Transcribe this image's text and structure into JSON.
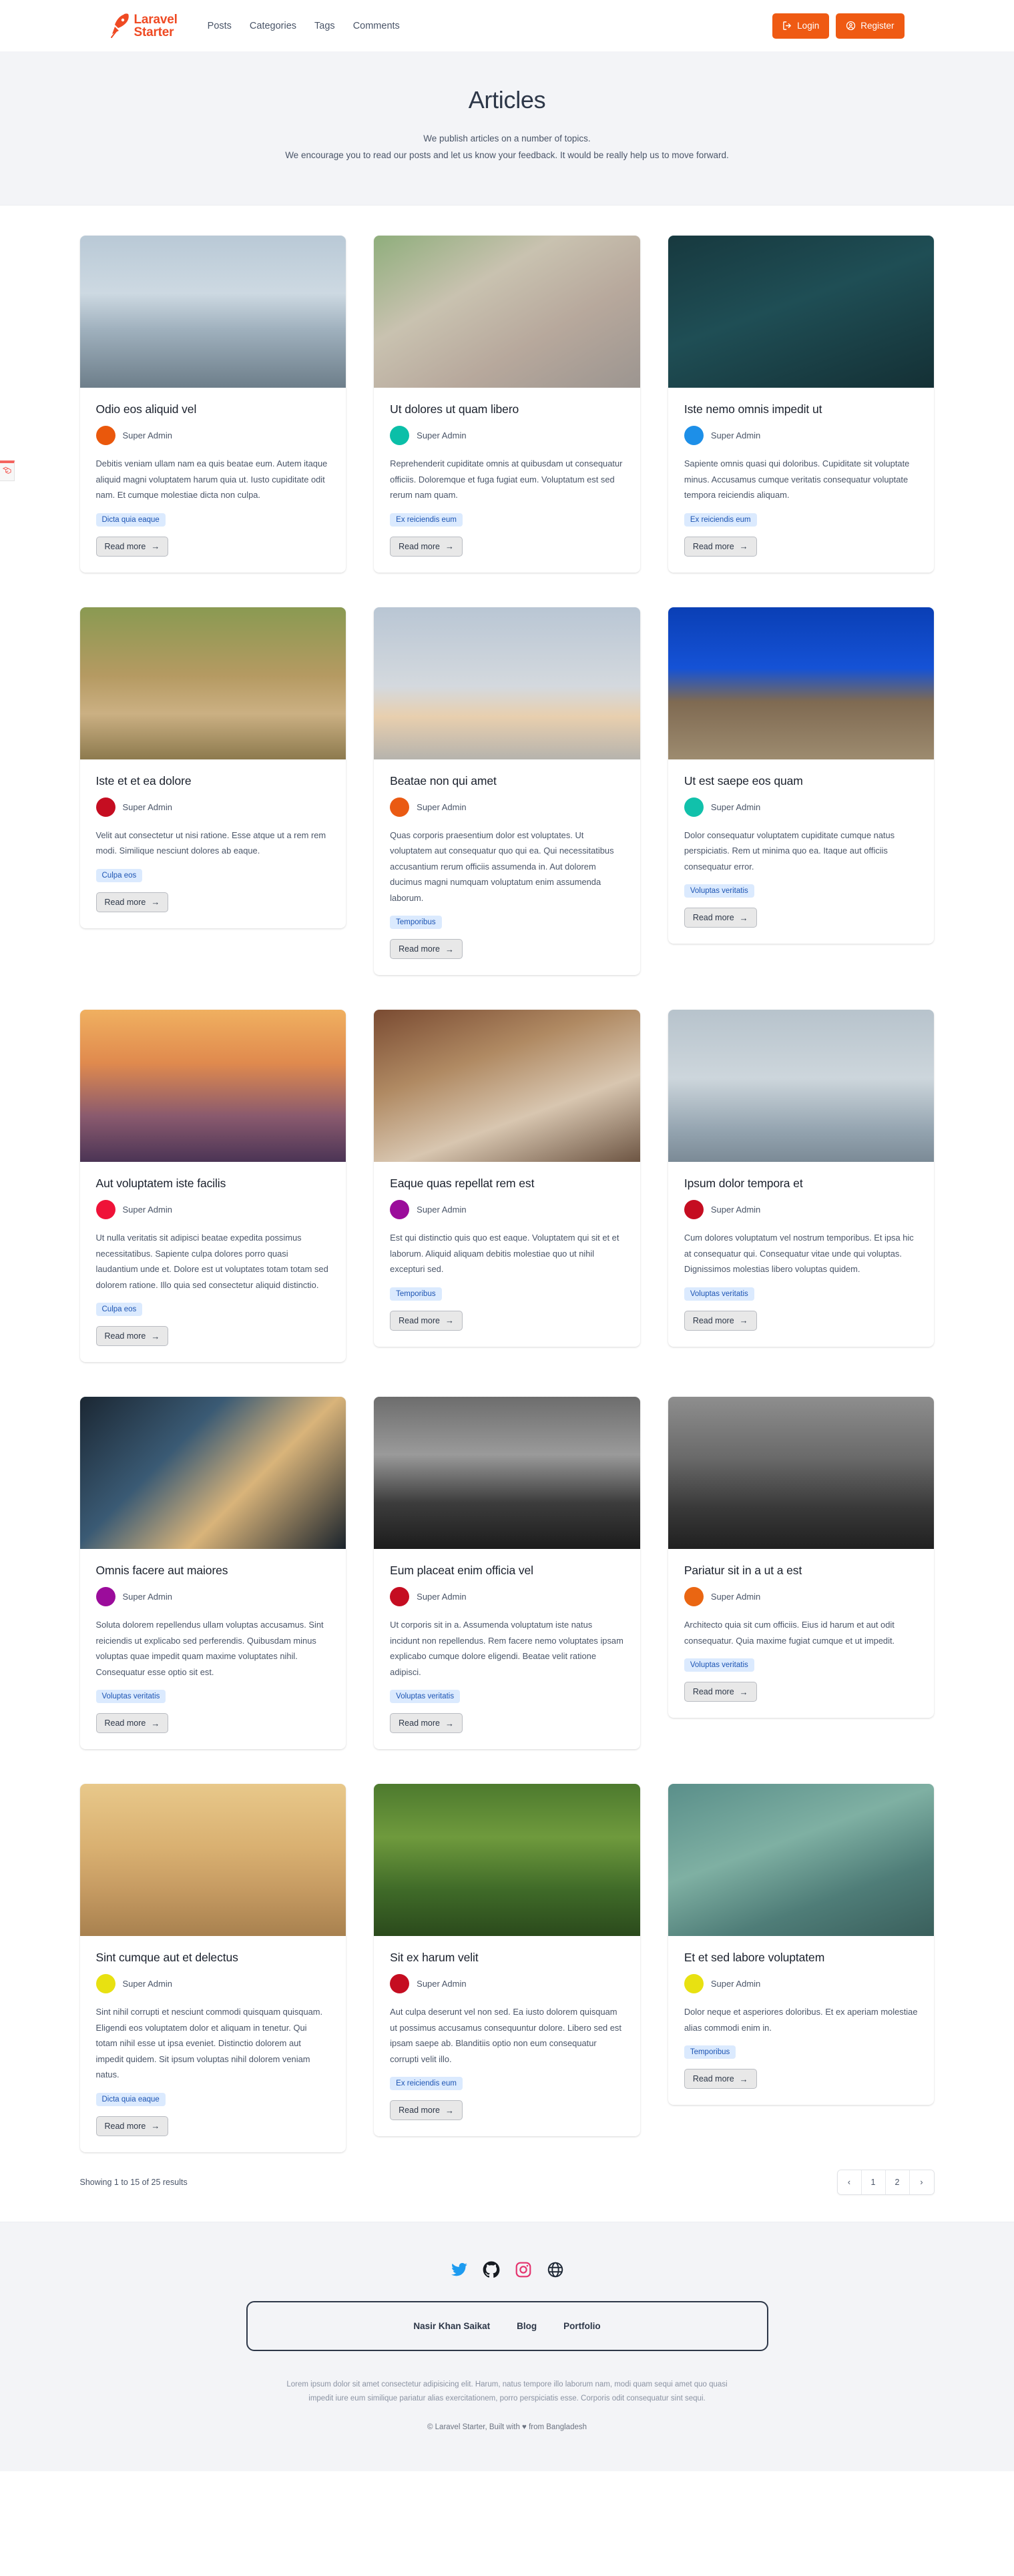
{
  "navbar": {
    "brand_line1": "Laravel",
    "brand_line2": "Starter",
    "brand_icon": "rocket-icon",
    "links": [
      {
        "label": "Posts"
      },
      {
        "label": "Categories"
      },
      {
        "label": "Tags"
      },
      {
        "label": "Comments"
      }
    ],
    "login_label": "Login",
    "register_label": "Register",
    "login_icon": "login-arrow-icon",
    "register_icon": "user-circle-icon",
    "accent_color": "#ef5a13",
    "brand_color": "#ef4a23"
  },
  "hero": {
    "title": "Articles",
    "line1": "We publish articles on a number of topics.",
    "line2": "We encourage you to read our posts and let us know your feedback. It would be really help us to move forward."
  },
  "cards": [
    {
      "title": "Odio eos aliquid vel",
      "author": "Super Admin",
      "avatar_color": "#ea580c",
      "excerpt": "Debitis veniam ullam nam ea quis beatae eum. Autem itaque aliquid magni voluptatem harum quia ut. Iusto cupiditate odit nam. Et cumque molestiae dicta non culpa.",
      "tag": "Dicta quia eaque",
      "read_more": "Read more",
      "image": "lake-pier-mountains"
    },
    {
      "title": "Ut dolores ut quam libero",
      "author": "Super Admin",
      "avatar_color": "#0bbfa8",
      "excerpt": "Reprehenderit cupiditate omnis at quibusdam ut consequatur officiis. Doloremque et fuga fugiat eum. Voluptatum est sed rerum nam quam.",
      "tag": "Ex reiciendis eum",
      "read_more": "Read more",
      "image": "city-street-people"
    },
    {
      "title": "Iste nemo omnis impedit ut",
      "author": "Super Admin",
      "avatar_color": "#1d8fe8",
      "excerpt": "Sapiente omnis quasi qui doloribus. Cupiditate sit voluptate minus. Accusamus cumque veritatis consequatur voluptate tempora reiciendis aliquam.",
      "tag": "Ex reiciendis eum",
      "read_more": "Read more",
      "image": "dark-teal-boat"
    },
    {
      "title": "Iste et et ea dolore",
      "author": "Super Admin",
      "avatar_color": "#c50d21",
      "excerpt": "Velit aut consectetur ut nisi ratione. Esse atque ut a rem rem modi. Similique nesciunt dolores ab eaque.",
      "tag": "Culpa eos",
      "read_more": "Read more",
      "image": "leopard-dirt-road"
    },
    {
      "title": "Beatae non qui amet",
      "author": "Super Admin",
      "avatar_color": "#ea5a13",
      "excerpt": "Quas corporis praesentium dolor est voluptates. Ut voluptatem aut consequatur quo qui ea. Qui necessitatibus accusantium rerum officiis assumenda in. Aut dolorem ducimus magni numquam voluptatum enim assumenda laborum.",
      "tag": "Temporibus",
      "read_more": "Read more",
      "image": "calm-sea-horizon"
    },
    {
      "title": "Ut est saepe eos quam",
      "author": "Super Admin",
      "avatar_color": "#11c1ab",
      "excerpt": "Dolor consequatur voluptatem cupiditate cumque natus perspiciatis. Rem ut minima quo ea. Itaque aut officiis consequatur error.",
      "tag": "Voluptas veritatis",
      "read_more": "Read more",
      "image": "star-trails-rocks"
    },
    {
      "title": "Aut voluptatem iste facilis",
      "author": "Super Admin",
      "avatar_color": "#ef1238",
      "excerpt": "Ut nulla veritatis sit adipisci beatae expedita possimus necessitatibus. Sapiente culpa dolores porro quasi laudantium unde et. Dolore est ut voluptates totam totam sed dolorem ratione. Illo quia sed consectetur aliquid distinctio.",
      "tag": "Culpa eos",
      "read_more": "Read more",
      "image": "sunset-runner-hill"
    },
    {
      "title": "Eaque quas repellat rem est",
      "author": "Super Admin",
      "avatar_color": "#9b0c9b",
      "excerpt": "Est qui distinctio quis quo est eaque. Voluptatem qui sit et et laborum. Aliquid aliquam debitis molestiae quo ut nihil excepturi sed.",
      "tag": "Temporibus",
      "read_more": "Read more",
      "image": "guitar-player-shop"
    },
    {
      "title": "Ipsum dolor tempora et",
      "author": "Super Admin",
      "avatar_color": "#c50d21",
      "excerpt": "Cum dolores voluptatum vel nostrum temporibus. Et ipsa hic at consequatur qui. Consequatur vitae unde qui voluptas. Dignissimos molestias libero voluptas quidem.",
      "tag": "Voluptas veritatis",
      "read_more": "Read more",
      "image": "city-skyline-haze"
    },
    {
      "title": "Omnis facere aut maiores",
      "author": "Super Admin",
      "avatar_color": "#9b0c9b",
      "excerpt": "Soluta dolorem repellendus ullam voluptas accusamus. Sint reiciendis ut explicabo sed perferendis. Quibusdam minus voluptas quae impedit quam maxime voluptates nihil. Consequatur esse optio sit est.",
      "tag": "Voluptas veritatis",
      "read_more": "Read more",
      "image": "train-station-tracks"
    },
    {
      "title": "Eum placeat enim officia vel",
      "author": "Super Admin",
      "avatar_color": "#c50d21",
      "excerpt": "Ut corporis sit in a. Assumenda voluptatum iste natus incidunt non repellendus. Rem facere nemo voluptates ipsam explicabo cumque dolore eligendi. Beatae velit ratione adipisci.",
      "tag": "Voluptas veritatis",
      "read_more": "Read more",
      "image": "bw-hills-fog"
    },
    {
      "title": "Pariatur sit in a ut a est",
      "author": "Super Admin",
      "avatar_color": "#ea6612",
      "excerpt": "Architecto quia sit cum officiis. Eius id harum et aut odit consequatur. Quia maxime fugiat cumque et ut impedit.",
      "tag": "Voluptas veritatis",
      "read_more": "Read more",
      "image": "bw-bare-tree"
    },
    {
      "title": "Sint cumque aut et delectus",
      "author": "Super Admin",
      "avatar_color": "#e8e111",
      "excerpt": "Sint nihil corrupti et nesciunt commodi quisquam quisquam. Eligendi eos voluptatem dolor et aliquam in tenetur. Qui totam nihil esse ut ipsa eveniet. Distinctio dolorem aut impedit quidem. Sit ipsum voluptas nihil dolorem veniam natus.",
      "tag": "Dicta quia eaque",
      "read_more": "Read more",
      "image": "desert-dunes"
    },
    {
      "title": "Sit ex harum velit",
      "author": "Super Admin",
      "avatar_color": "#c50d21",
      "excerpt": "Aut culpa deserunt vel non sed. Ea iusto dolorem quisquam ut possimus accusamus consequuntur dolore. Libero sed est ipsam saepe ab. Blanditiis optio non eum consequatur corrupti velit illo.",
      "tag": "Ex reiciendis eum",
      "read_more": "Read more",
      "image": "green-forest-river"
    },
    {
      "title": "Et et sed labore voluptatem",
      "author": "Super Admin",
      "avatar_color": "#e8e111",
      "excerpt": "Dolor neque et asperiores doloribus. Et ex aperiam molestiae alias commodi enim in.",
      "tag": "Temporibus",
      "read_more": "Read more",
      "image": "succulent-plants"
    }
  ],
  "pagination": {
    "results_text": "Showing 1 to 15 of 25 results",
    "prev_label": "‹",
    "next_label": "›",
    "pages": [
      "1",
      "2"
    ],
    "current_page": "1"
  },
  "footer": {
    "social": [
      {
        "name": "twitter-icon",
        "color": "#1d9bf0"
      },
      {
        "name": "github-icon",
        "color": "#161b22"
      },
      {
        "name": "instagram-icon",
        "color": "#e4346f"
      },
      {
        "name": "globe-icon",
        "color": "#1f2937"
      }
    ],
    "nav": [
      {
        "label": "Nasir Khan Saikat"
      },
      {
        "label": "Blog"
      },
      {
        "label": "Portfolio"
      }
    ],
    "lorem": "Lorem ipsum dolor sit amet consectetur adipisicing elit. Harum, natus tempore illo laborum nam, modi quam sequi amet quo quasi impedit iure eum similique pariatur alias exercitationem, porro perspiciatis esse. Corporis odit consequatur sint sequi.",
    "copyright": "© Laravel Starter, Built with ♥ from Bangladesh"
  },
  "debugbar": {
    "icon": "laravel-icon"
  }
}
